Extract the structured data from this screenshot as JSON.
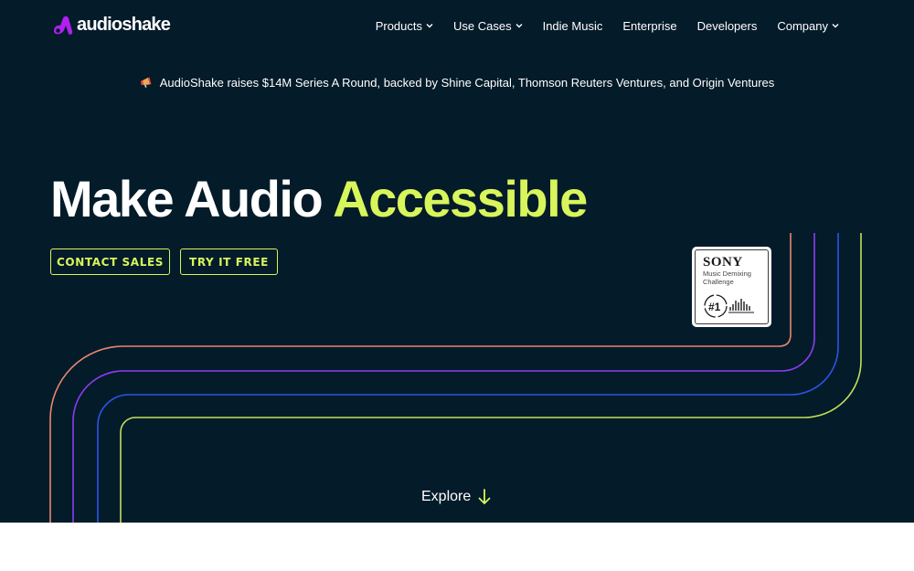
{
  "header": {
    "logo_text": "audioshake",
    "nav": [
      {
        "label": "Products",
        "has_dropdown": true
      },
      {
        "label": "Use Cases",
        "has_dropdown": true
      },
      {
        "label": "Indie Music",
        "has_dropdown": false
      },
      {
        "label": "Enterprise",
        "has_dropdown": false
      },
      {
        "label": "Developers",
        "has_dropdown": false
      },
      {
        "label": "Company",
        "has_dropdown": true
      }
    ]
  },
  "announcement": {
    "icon": "megaphone-icon",
    "text": "AudioShake raises $14M Series A Round, backed by Shine Capital, Thomson Reuters Ventures, and Origin Ventures"
  },
  "hero": {
    "headline_main": "Make Audio",
    "headline_accent": "Accessible",
    "buttons": {
      "contact": "CONTACT SALES",
      "try": "TRY IT FREE"
    },
    "badge": {
      "brand": "SONY",
      "line1": "Music Demixing",
      "line2": "Challenge",
      "rank": "#1"
    },
    "explore_label": "Explore"
  },
  "colors": {
    "background": "#041b2a",
    "accent": "#d8f55b",
    "logo": "#b020f0",
    "line_orange": "#e8866e",
    "line_purple": "#8b3df0",
    "line_blue": "#2d55e8",
    "line_lime": "#c3e05a"
  }
}
